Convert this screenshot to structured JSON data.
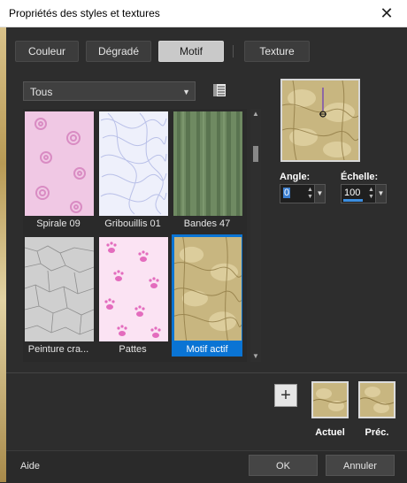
{
  "window": {
    "title": "Propriétés des styles et textures",
    "close_glyph": "✕"
  },
  "tabs": [
    {
      "label": "Couleur"
    },
    {
      "label": "Dégradé"
    },
    {
      "label": "Motif"
    },
    {
      "label": "Texture"
    }
  ],
  "active_tab": "Motif",
  "category": {
    "selected": "Tous"
  },
  "patterns": [
    {
      "label": "Spirale 09"
    },
    {
      "label": "Gribouillis 01"
    },
    {
      "label": "Bandes 47"
    },
    {
      "label": "Peinture cra..."
    },
    {
      "label": "Pattes"
    },
    {
      "label": "Motif actif"
    }
  ],
  "selected_pattern": "Motif actif",
  "angle": {
    "label": "Angle:",
    "value": "0"
  },
  "scale": {
    "label": "Échelle:",
    "value": "100"
  },
  "swatches": {
    "current_label": "Actuel",
    "previous_label": "Préc."
  },
  "footer": {
    "help": "Aide",
    "ok": "OK",
    "cancel": "Annuler"
  },
  "colors": {
    "accent": "#0a74d4",
    "background": "#2d2d2d"
  }
}
